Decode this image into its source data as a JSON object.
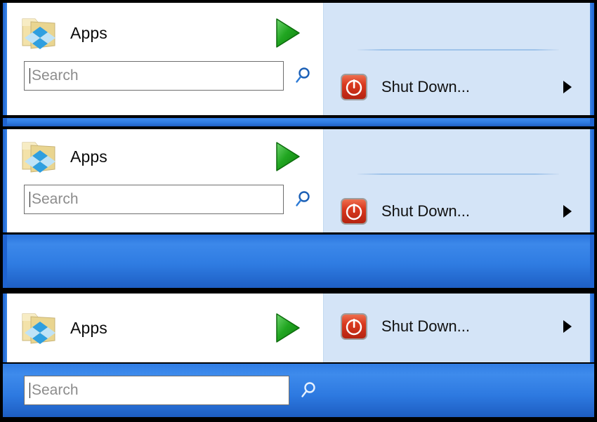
{
  "meta": {
    "variants": 3,
    "colors": {
      "accent_blue": "#2f7ce2",
      "panel_right_bg": "#d4e4f7",
      "panel_left_bg": "#ffffff",
      "separator": "#9fc3ea",
      "power_red": "#d9381e",
      "play_green": "#1a9e1a",
      "search_border": "#6f6f6f",
      "placeholder_text": "#8c8c8c",
      "label_text": "#0b0b0b"
    }
  },
  "panels": [
    {
      "id": "panel-1",
      "apps": {
        "label": "Apps",
        "folder_icon": "folder-apps-icon",
        "expand_icon": "play-arrow-icon"
      },
      "search": {
        "placeholder": "Search",
        "value": "",
        "icon": "search-magnifier-icon"
      },
      "power": {
        "label": "Shut Down...",
        "icon": "power-shutdown-icon",
        "submenu_icon": "chevron-right-icon",
        "has_separator": true
      },
      "search_on_blue": false
    },
    {
      "id": "panel-2",
      "apps": {
        "label": "Apps",
        "folder_icon": "folder-apps-icon",
        "expand_icon": "play-arrow-icon"
      },
      "search": {
        "placeholder": "Search",
        "value": "",
        "icon": "search-magnifier-icon"
      },
      "power": {
        "label": "Shut Down...",
        "icon": "power-shutdown-icon",
        "submenu_icon": "chevron-right-icon",
        "has_separator": true
      },
      "search_on_blue": false
    },
    {
      "id": "panel-3",
      "apps": {
        "label": "Apps",
        "folder_icon": "folder-apps-icon",
        "expand_icon": "play-arrow-icon"
      },
      "search": {
        "placeholder": "Search",
        "value": "",
        "icon": "search-magnifier-icon"
      },
      "power": {
        "label": "Shut Down...",
        "icon": "power-shutdown-icon",
        "submenu_icon": "chevron-right-icon",
        "has_separator": false
      },
      "search_on_blue": true
    }
  ]
}
